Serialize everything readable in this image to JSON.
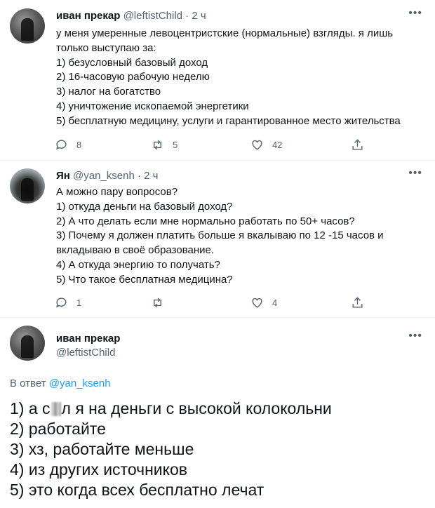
{
  "tweet1": {
    "name": "иван прекар",
    "handle": "@leftistChild",
    "separator": "·",
    "time": "2 ч",
    "lines": [
      "у меня умеренные левоцентристские (нормальные) взгляды. я лишь",
      "только выступаю за:",
      "1) безусловный базовый доход",
      "2) 16-часовую рабочую неделю",
      "3) налог на богатство",
      "4) уничтожение ископаемой энергетики",
      "5) бесплатную медицину, услуги и гарантированное место жительства"
    ],
    "replies": "8",
    "retweets": "5",
    "likes": "42"
  },
  "tweet2": {
    "name": "Ян",
    "handle": "@yan_ksenh",
    "separator": "·",
    "time": "2 ч",
    "lines": [
      "А можно пару вопросов?",
      "1) откуда деньги на базовый доход?",
      "2) А что делать если мне нормально работать по 50+ часов?",
      "3) Почему я должен платить больше я вкалываю по 12 -15 часов и",
      "вкладываю в своё образование.",
      "4) А откуда энергию то получать?",
      "5) Что такое бесплатная медицина?"
    ],
    "replies": "1",
    "retweets": "",
    "likes": "4"
  },
  "tweet3": {
    "name": "иван прекар",
    "handle": "@leftistChild",
    "reply_prefix": "В ответ",
    "reply_to": "@yan_ksenh",
    "line1_start": "1) а с",
    "line1_end": "л я на деньги с высокой колокольни",
    "lines": [
      "2) работайте",
      "3) хз, работайте меньше",
      "4) из других источников",
      "5) это когда всех бесплатно лечат"
    ]
  },
  "icons": {
    "more": "more-horizontal-icon",
    "reply": "reply-bubble-icon",
    "retweet": "retweet-icon",
    "like": "heart-icon",
    "share": "share-icon"
  },
  "colors": {
    "text": "#0f1419",
    "muted": "#536471",
    "link": "#1d9bf0"
  }
}
